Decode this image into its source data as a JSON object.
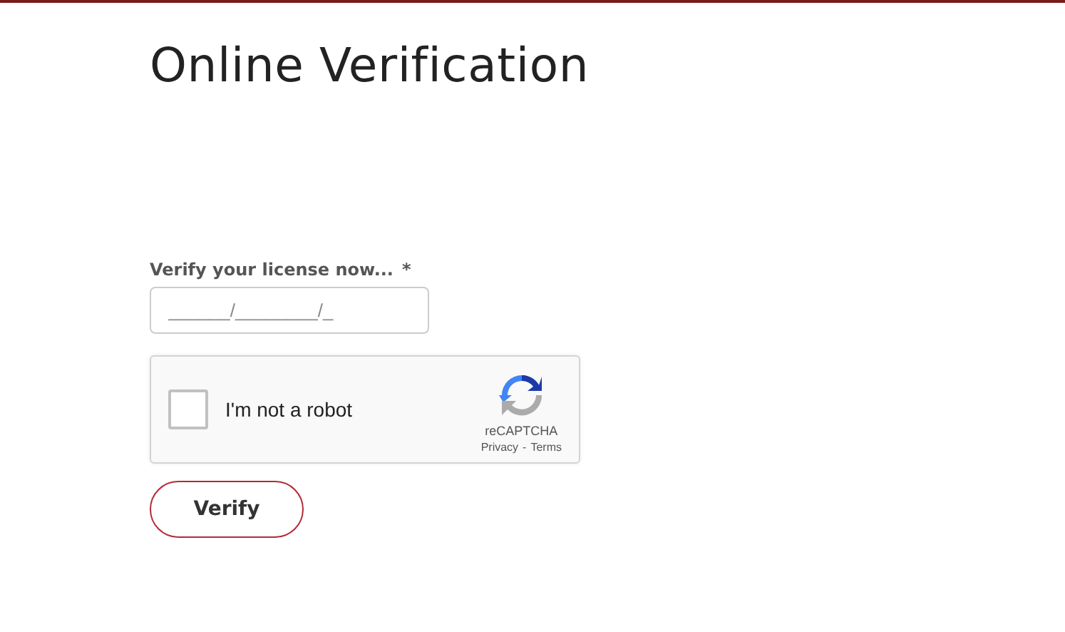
{
  "title": "Online Verification",
  "license_field": {
    "label": "Verify your license now...",
    "required_mark": "*",
    "placeholder": "______/________/_"
  },
  "captcha": {
    "label": "I'm not a robot",
    "checked": false,
    "brand": "reCAPTCHA",
    "privacy": "Privacy",
    "separator": "-",
    "terms": "Terms"
  },
  "submit_button": "Verify"
}
